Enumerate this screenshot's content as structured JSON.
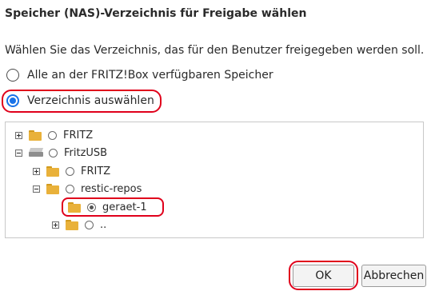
{
  "dialog": {
    "title": "Speicher (NAS)-Verzeichnis für Freigabe wählen",
    "description": "Wählen Sie das Verzeichnis, das für den Benutzer freigegeben werden soll."
  },
  "options": [
    {
      "label": "Alle an der FRITZ!Box verfügbaren Speicher",
      "checked": false
    },
    {
      "label": "Verzeichnis auswählen",
      "checked": true
    }
  ],
  "tree": [
    {
      "label": "FRITZ",
      "expander": "plus",
      "icon": "folder-icon",
      "checked": false
    },
    {
      "label": "FritzUSB",
      "expander": "minus",
      "icon": "drive-icon",
      "checked": false
    },
    {
      "label": "FRITZ",
      "expander": "plus",
      "icon": "folder-icon",
      "checked": false
    },
    {
      "label": "restic-repos",
      "expander": "minus",
      "icon": "folder-icon",
      "checked": false
    },
    {
      "label": "geraet-1",
      "expander": "none",
      "icon": "folder-icon",
      "checked": true
    },
    {
      "label": "..",
      "expander": "plus",
      "icon": "folder-icon",
      "checked": false
    }
  ],
  "buttons": {
    "ok": "OK",
    "cancel": "Abbrechen"
  },
  "colors": {
    "highlight": "#e0001b",
    "accent": "#1a73e8",
    "folder": "#e9b13a"
  }
}
